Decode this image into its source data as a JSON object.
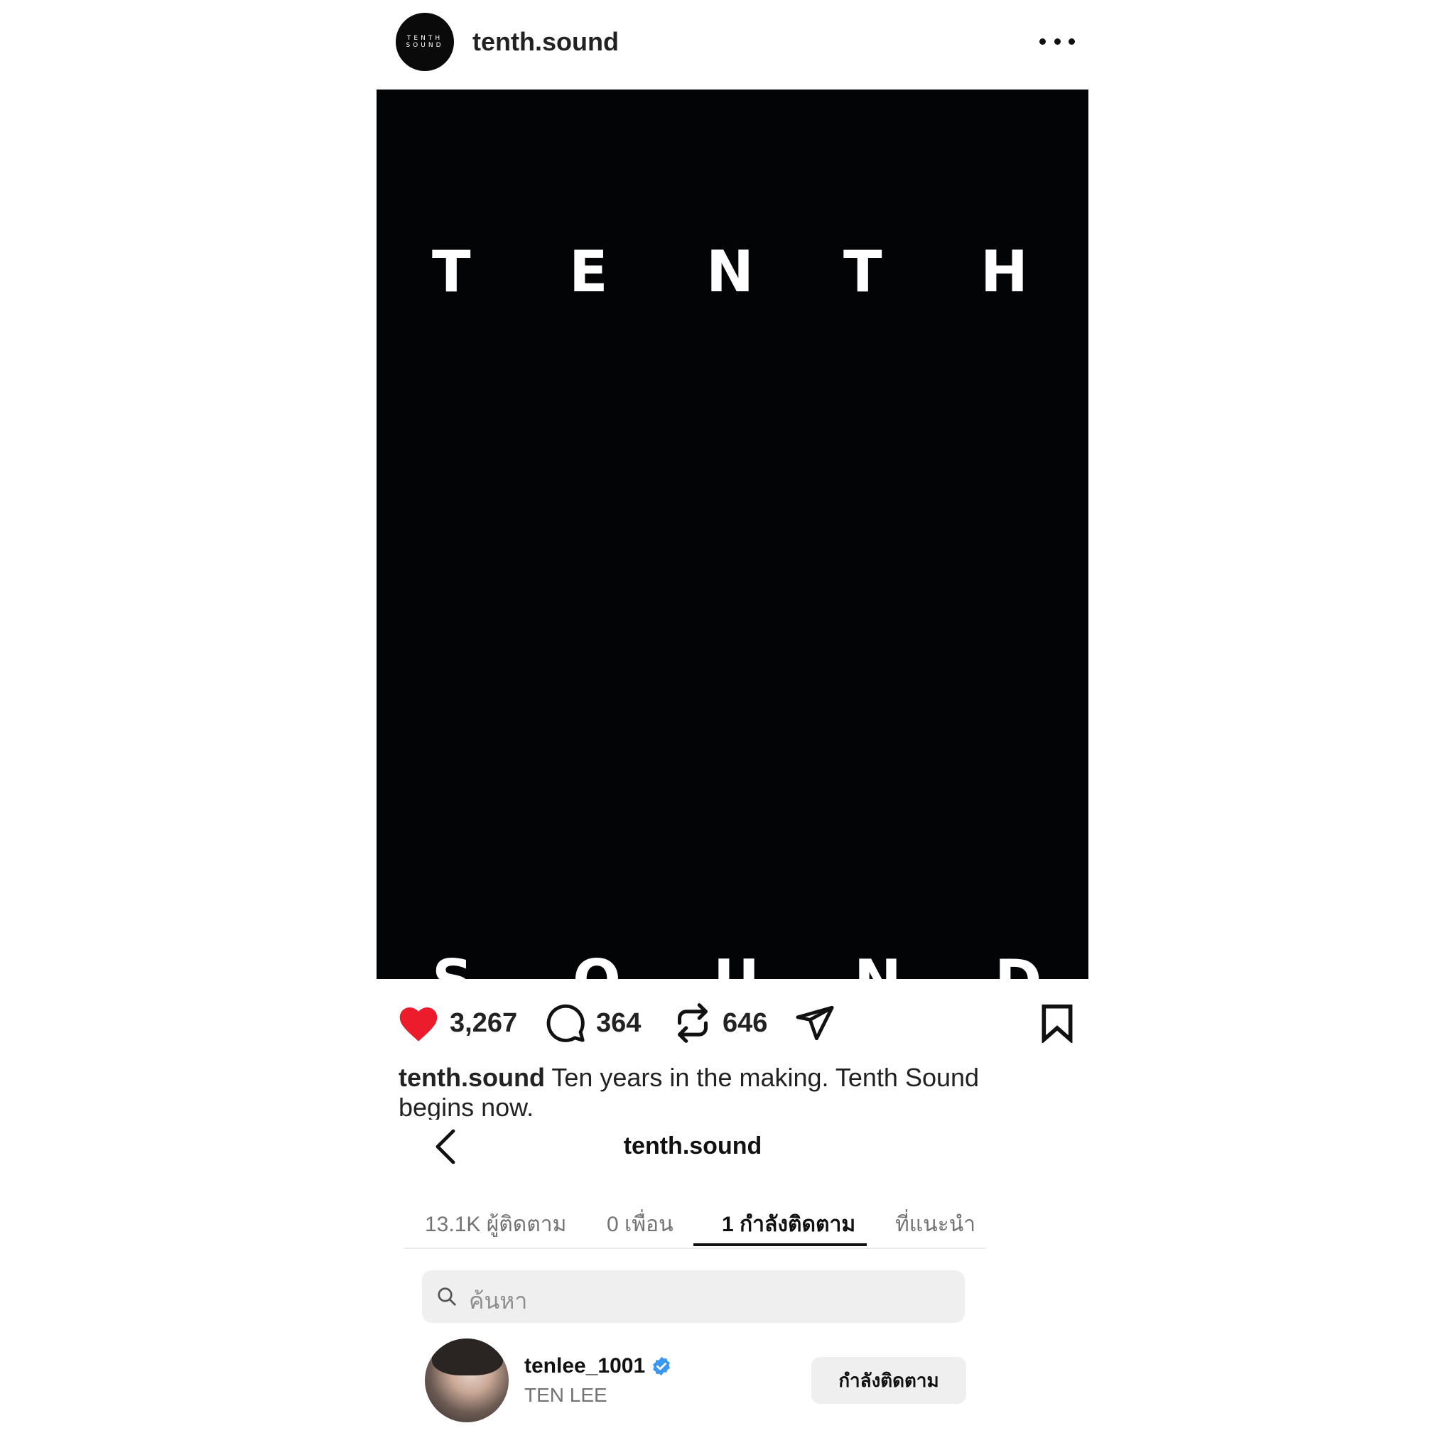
{
  "post": {
    "username": "tenth.sound",
    "avatar_logo_lines": [
      "TENTH",
      "SOUND"
    ],
    "image_letters_top": [
      "T",
      "E",
      "N",
      "T",
      "H"
    ],
    "image_letters_bottom": [
      "S",
      "O",
      "U",
      "N",
      "D"
    ],
    "likes": "3,267",
    "comments": "364",
    "reposts": "646",
    "caption_user": "tenth.sound",
    "caption_text": "Ten years in the making. Tenth Sound begins now.",
    "like_color": "#ed1c2c"
  },
  "following_panel": {
    "title": "tenth.sound",
    "tabs": [
      {
        "label": "13.1K ผู้ติดตาม"
      },
      {
        "label": "0 เพื่อน"
      },
      {
        "label": "1 กำลังติดตาม"
      },
      {
        "label": "ที่แนะนำ"
      }
    ],
    "active_tab": 2,
    "search_placeholder": "ค้นหา",
    "users": [
      {
        "handle": "tenlee_1001",
        "full_name": "TEN LEE",
        "verified": true,
        "button_label": "กำลังติดตาม"
      }
    ],
    "verified_color": "#3897f0"
  }
}
